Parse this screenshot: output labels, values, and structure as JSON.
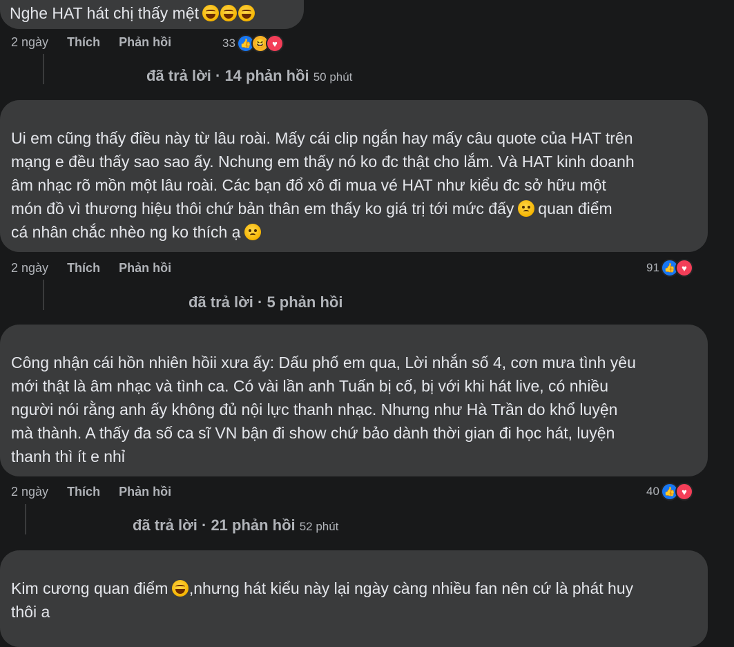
{
  "comments": [
    {
      "text": "Nghe HAT hát chị thấy mệt",
      "emoji": "laugh",
      "time": "2 ngày",
      "like_label": "Thích",
      "reply_label": "Phản hồi",
      "reaction_count": "33",
      "reactions": [
        "like-icon",
        "haha-icon",
        "love-icon"
      ],
      "replies": {
        "summary": "đã trả lời · 14 phản hồi",
        "time": "50 phút"
      }
    },
    {
      "text": "Ui em cũng thấy điều này từ lâu roài. Mấy cái clip ngắn hay mấy câu quote của HAT trên\nmạng e đều thấy sao sao ấy. Nchung em thấy nó ko đc thật cho lắm. Và HAT kinh doanh\nâm nhạc rõ mồn một lâu roài. Các bạn đổ xô đi mua vé HAT như kiểu đc sở hữu một\nmón đồ vì thương hiệu thôi chứ bản thân em thấy ko giá trị tới mức đấy",
      "text_b": "quan điểm\ncá nhân chắc nhèo ng ko thích ạ",
      "emoji": "sad",
      "time": "2 ngày",
      "like_label": "Thích",
      "reply_label": "Phản hồi",
      "reaction_count": "91",
      "reactions": [
        "like-icon",
        "love-icon"
      ],
      "replies": {
        "summary": "đã trả lời · 5 phản hồi",
        "time": ""
      }
    },
    {
      "text": "Công nhận cái hồn nhiên hồii xưa ấy: Dấu phố em qua, Lời nhắn số 4, cơn mưa tình yêu\nmới thật là âm nhạc và tình ca. Có vài lần anh Tuấn bị cố, bị với khi hát live, có nhiều\nngười nói rằng anh ấy không đủ nội lực thanh nhạc. Nhưng như Hà Trần do khổ luyện\nmà thành. A thấy đa số ca sĩ VN bận đi show chứ bảo dành thời gian đi học hát, luyện\nthanh thì ít e nhỉ",
      "time": "2 ngày",
      "like_label": "Thích",
      "reply_label": "Phản hồi",
      "reaction_count": "40",
      "reactions": [
        "like-icon",
        "love-icon"
      ],
      "replies": {
        "summary": "đã trả lời · 21 phản hồi",
        "time": "52 phút"
      }
    },
    {
      "text_a": "Kim cương quan điểm",
      "text_b": ",nhưng hát kiểu này lại ngày càng nhiều fan nên cứ là phát huy\nthôi a",
      "emoji": "laugh"
    }
  ],
  "colors": {
    "background": "#18191a",
    "bubble": "#3a3b3c",
    "text": "#e4e6eb",
    "muted": "#b0b3b8",
    "like": "#1877f2",
    "love": "#f33e58"
  }
}
